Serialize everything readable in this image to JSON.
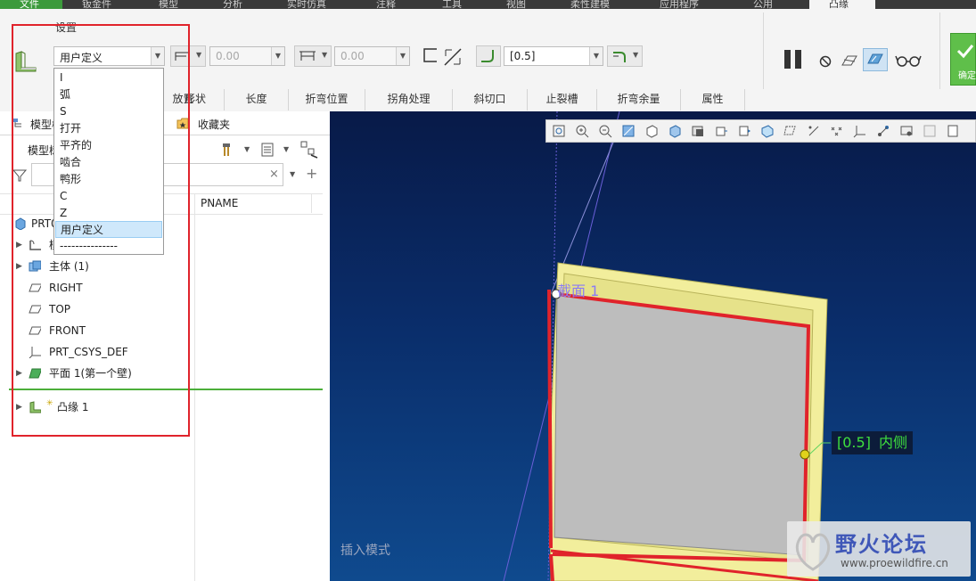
{
  "tabs": [
    "文件",
    "钣金件",
    "模型",
    "分析",
    "实时仿真",
    "注释",
    "工具",
    "视图",
    "柔性建模",
    "应用程序",
    "公用",
    "凸缘"
  ],
  "ribbon": {
    "group_settings": "设置",
    "shape_select": "用户定义",
    "length1_value": "0.00",
    "length2_value": "0.00",
    "bend_radius_value": "[0.5]",
    "confirm_label": "确定"
  },
  "subtabs": [
    "放置",
    "形状",
    "长度",
    "折弯位置",
    "拐角处理",
    "斜切口",
    "止裂槽",
    "折弯余量",
    "属性"
  ],
  "dropdown_options": [
    "I",
    "弧",
    "S",
    "打开",
    "平齐的",
    "啮合",
    "鸭形",
    "C",
    "Z",
    "用户定义",
    "---------------"
  ],
  "dropdown_selected_index": 9,
  "panel": {
    "tab_model_tree": "模型树",
    "tab_favorites": "收藏夹",
    "model_tree_label": "模型树",
    "search_placeholder": "",
    "col_name": "PNAME"
  },
  "tree": [
    {
      "label": "PRT0001.PRT",
      "icon": "part-icon"
    },
    {
      "label": "模型",
      "icon": "sheetmetal-icon"
    },
    {
      "label": "主体 (1)",
      "icon": "body-icon"
    },
    {
      "label": "RIGHT",
      "icon": "datum-plane-icon"
    },
    {
      "label": "TOP",
      "icon": "datum-plane-icon"
    },
    {
      "label": "FRONT",
      "icon": "datum-plane-icon"
    },
    {
      "label": "PRT_CSYS_DEF",
      "icon": "csys-icon"
    },
    {
      "label": "平面 1(第一个壁)",
      "icon": "planar-wall-icon"
    },
    {
      "label": "凸缘 1",
      "icon": "flange-icon"
    }
  ],
  "viewport": {
    "section_label": "截面 1",
    "radius_tag_value": "[0.5]",
    "radius_tag_side": "内侧",
    "mode_text": "插入模式"
  },
  "watermark": {
    "title": "野火论坛",
    "url": "www.proewildfire.cn"
  },
  "colors": {
    "file_tab": "#3c9a3c",
    "viewport_top": "#081a48",
    "viewport_bottom": "#0f4a8e",
    "highlight_red": "#e0232b",
    "selection_blue": "#cfe8fb"
  }
}
